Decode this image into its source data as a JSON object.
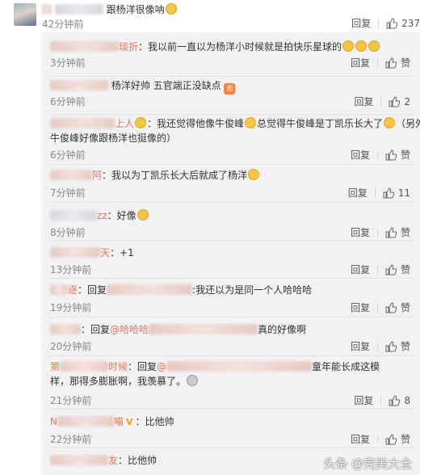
{
  "main_comment": {
    "text": "跟杨洋很像呐",
    "time": "42分钟前",
    "reply": "回复",
    "likes": "237"
  },
  "replies": [
    {
      "user_suffix": "琰折",
      "text": "：我以前一直以为杨洋小时候就是拍快乐星球的",
      "time": "3分钟前",
      "reply": "回复",
      "likes": "赞"
    },
    {
      "text": "杨洋好帅 五官端正没缺点",
      "time": "6分钟前",
      "reply": "回复",
      "likes": "2"
    },
    {
      "user_suffix": "上人",
      "text": "：我还觉得他像牛俊峰",
      "text2": "总觉得牛俊峰是丁凯乐长大了",
      "text3": "（另外",
      "line2": "牛俊峰好像跟杨洋也挺像的）",
      "time": "6分钟前",
      "reply": "回复",
      "likes": "赞"
    },
    {
      "user_suffix": "阿",
      "text": "：我以为丁凯乐长大后就成了杨洋",
      "time": "7分钟前",
      "reply": "回复",
      "likes": "11"
    },
    {
      "user_suffix": "zz",
      "text": "：好像",
      "time": "8分钟前",
      "reply": "回复",
      "likes": "赞"
    },
    {
      "user_suffix": "天",
      "text": "：+1",
      "time": "13分钟前",
      "reply": "回复",
      "likes": "赞"
    },
    {
      "user_suffix": "逐",
      "text_a": "：回复",
      "text_b": ":我还以为是同一个人哈哈哈",
      "time": "19分钟前",
      "reply": "回复",
      "likes": "赞"
    },
    {
      "text_a": "：回复",
      "mention": "@哈哈哈",
      "text_b": "真的好像啊",
      "time": "20分钟前",
      "reply": "回复",
      "likes": "赞"
    },
    {
      "user_prefix": "第",
      "user_suffix": "时候",
      "text_a": "：回复",
      "mention": "@",
      "text_b": "童年能长成这模",
      "line2": "样，那得多膨胀啊，我羡慕了。",
      "time": "21分钟前",
      "reply": "回复",
      "likes": "8"
    },
    {
      "user_prefix": "N",
      "user_suffix": "喵",
      "badge": "V",
      "text": "：比他帅",
      "time": "22分钟前",
      "reply": "回复",
      "likes": "赞"
    },
    {
      "user_suffix": "友",
      "text": "：比他帅"
    }
  ],
  "watermark": "头条 @完美大全",
  "colors": {
    "username": "#eb7350",
    "panel": "#f2f2f5",
    "badge_v": "#f2a100"
  }
}
